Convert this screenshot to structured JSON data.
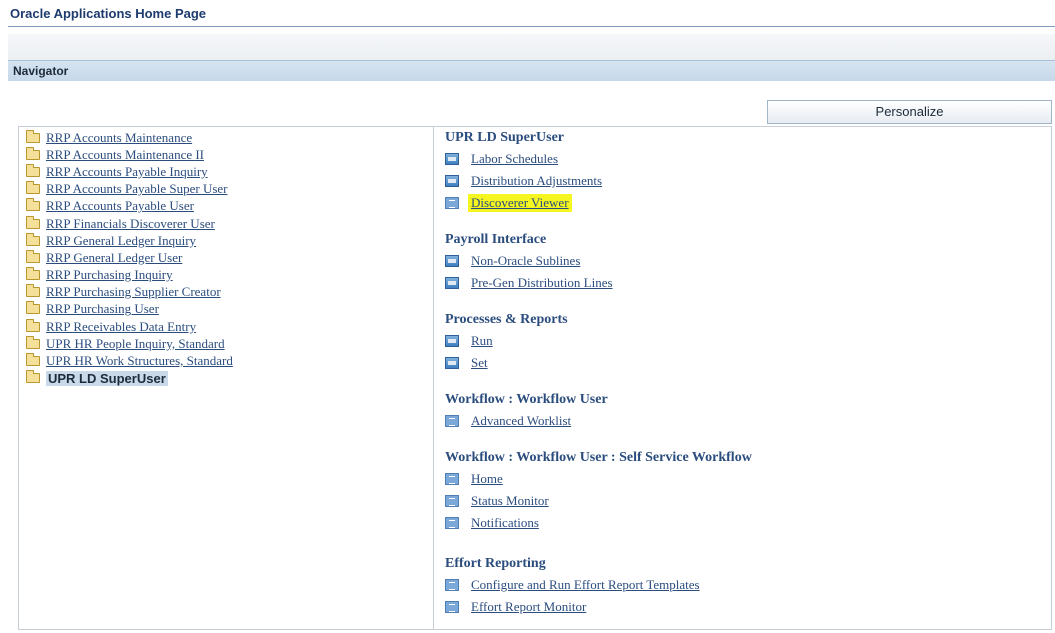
{
  "page": {
    "title": "Oracle Applications Home Page"
  },
  "navigator": {
    "header": "Navigator",
    "personalize_label": "Personalize"
  },
  "responsibilities": [
    {
      "label": "RRP Accounts Maintenance",
      "selected": false
    },
    {
      "label": "RRP Accounts Maintenance II",
      "selected": false
    },
    {
      "label": "RRP Accounts Payable Inquiry",
      "selected": false
    },
    {
      "label": "RRP Accounts Payable Super User",
      "selected": false
    },
    {
      "label": "RRP Accounts Payable User",
      "selected": false
    },
    {
      "label": "RRP Financials Discoverer User",
      "selected": false
    },
    {
      "label": "RRP General Ledger Inquiry",
      "selected": false
    },
    {
      "label": "RRP General Ledger User",
      "selected": false
    },
    {
      "label": "RRP Purchasing Inquiry",
      "selected": false
    },
    {
      "label": "RRP Purchasing Supplier Creator",
      "selected": false
    },
    {
      "label": "RRP Purchasing User",
      "selected": false
    },
    {
      "label": "RRP Receivables Data Entry",
      "selected": false
    },
    {
      "label": "UPR HR People Inquiry, Standard",
      "selected": false
    },
    {
      "label": "UPR HR Work Structures, Standard",
      "selected": false
    },
    {
      "label": "UPR LD SuperUser",
      "selected": true
    }
  ],
  "functions": [
    {
      "title": "UPR LD SuperUser",
      "links": [
        {
          "label": "Labor Schedules",
          "icon": "form-icon",
          "highlighted": false
        },
        {
          "label": "Distribution Adjustments",
          "icon": "form-icon",
          "highlighted": false
        },
        {
          "label": "Discoverer Viewer",
          "icon": "page-icon",
          "highlighted": true
        }
      ]
    },
    {
      "title": "Payroll Interface",
      "links": [
        {
          "label": "Non-Oracle Sublines",
          "icon": "form-icon",
          "highlighted": false
        },
        {
          "label": "Pre-Gen Distribution Lines",
          "icon": "form-icon",
          "highlighted": false
        }
      ]
    },
    {
      "title": "Processes & Reports",
      "links": [
        {
          "label": "Run",
          "icon": "form-icon",
          "highlighted": false
        },
        {
          "label": "Set",
          "icon": "form-icon",
          "highlighted": false
        }
      ]
    },
    {
      "title": "Workflow : Workflow User",
      "links": [
        {
          "label": "Advanced Worklist",
          "icon": "page-icon",
          "highlighted": false
        }
      ]
    },
    {
      "title": "Workflow : Workflow User : Self Service Workflow",
      "links": [
        {
          "label": "Home",
          "icon": "page-icon",
          "highlighted": false
        },
        {
          "label": "Status Monitor",
          "icon": "page-icon",
          "highlighted": false
        },
        {
          "label": "Notifications",
          "icon": "page-icon",
          "highlighted": false
        }
      ]
    },
    {
      "title": "Effort Reporting",
      "links": [
        {
          "label": "Configure and Run Effort Report Templates",
          "icon": "page-icon",
          "highlighted": false
        },
        {
          "label": "Effort Report Monitor",
          "icon": "page-icon",
          "highlighted": false
        }
      ]
    }
  ],
  "colors": {
    "link": "#2b4d7e",
    "highlight": "#f5f51f",
    "header_band": "#c6d8ea"
  }
}
